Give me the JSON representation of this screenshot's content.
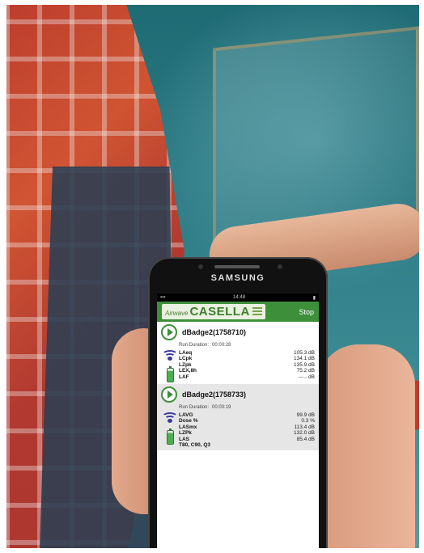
{
  "phone": {
    "brand": "SAMSUNG",
    "status_time": "14:48"
  },
  "app": {
    "logo_prefix": "Airwave",
    "logo_name": "CASELLA",
    "stop_label": "Stop",
    "accent": "#3e8f3a"
  },
  "devices": [
    {
      "name": "dBadge2(1758710)",
      "run_label": "Run Duration:",
      "run_value": "00:00:28",
      "metrics": [
        {
          "key": "LAeq",
          "value": "105.3 dB"
        },
        {
          "key": "LCpk",
          "value": "134.1 dB"
        },
        {
          "key": "LZpk",
          "value": "135.9 dB"
        },
        {
          "key": "LEX,8h",
          "value": "75.2 dB"
        },
        {
          "key": "LAF",
          "value": "---.- dB"
        }
      ]
    },
    {
      "name": "dBadge2(1758733)",
      "run_label": "Run Duration:",
      "run_value": "00:00:19",
      "metrics": [
        {
          "key": "LAVG",
          "value": "99.9 dB"
        },
        {
          "key": "Dose %",
          "value": "0.3 %"
        },
        {
          "key": "LASmx",
          "value": "113.4 dB"
        },
        {
          "key": "LZPk",
          "value": "132.0 dB"
        },
        {
          "key": "LAS",
          "value": "85.4 dB"
        },
        {
          "key": "T80, C90, Q3",
          "value": ""
        }
      ]
    }
  ]
}
